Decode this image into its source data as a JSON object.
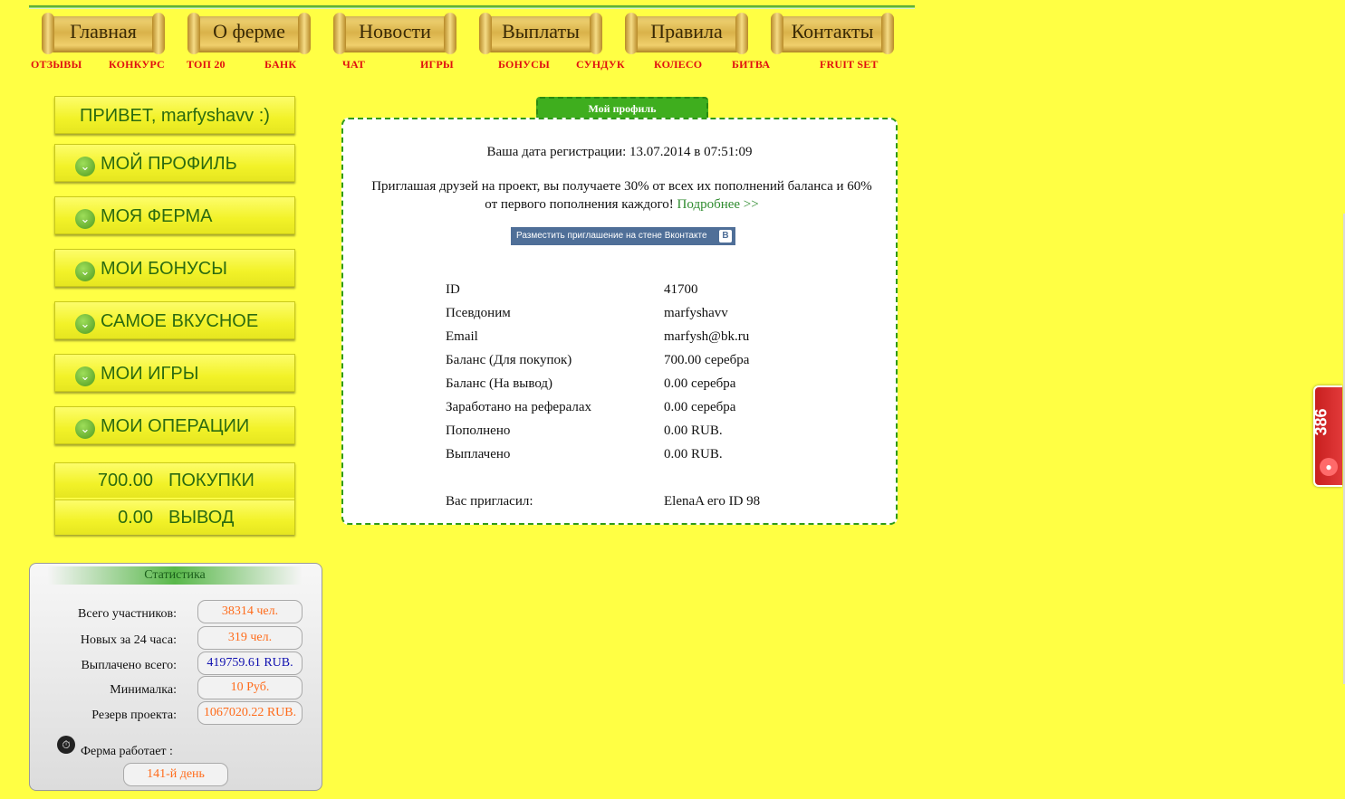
{
  "top_nav": [
    "Главная",
    "О ферме",
    "Новости",
    "Выплаты",
    "Правила",
    "Контакты"
  ],
  "sub_nav": [
    "ОТЗЫВЫ",
    "КОНКУРС",
    "ТОП 20",
    "БАНК",
    "ЧАТ",
    "ИГРЫ",
    "БОНУСЫ",
    "СУНДУК",
    "КОЛЕСО",
    "БИТВА",
    "FRUIT SET"
  ],
  "sidebar": {
    "greeting": "ПРИВЕТ, marfyshavv :)",
    "items": [
      "МОЙ ПРОФИЛЬ",
      "МОЯ ФЕРМА",
      "МОИ БОНУСЫ",
      "САМОЕ ВКУСНОЕ",
      "МОИ ИГРЫ",
      "МОИ ОПЕРАЦИИ"
    ],
    "balance_buy": {
      "value": "700.00",
      "label": "ПОКУПКИ"
    },
    "balance_out": {
      "value": "0.00",
      "label": "ВЫВОД"
    }
  },
  "stats": {
    "title": "Статистика",
    "rows": [
      {
        "label": "Всего участников:",
        "value": "38314 чел."
      },
      {
        "label": "Новых за 24 часа:",
        "value": "319 чел."
      },
      {
        "label": "Выплачено всего:",
        "value": "419759.61 RUB."
      },
      {
        "label": "Минималка:",
        "value": "10 Руб."
      },
      {
        "label": "Резерв проекта:",
        "value": "1067020.22 RUB."
      }
    ],
    "farm_label": "Ферма работает :",
    "farm_value": "141-й день"
  },
  "profile": {
    "tab_title": "Мой профиль",
    "reg_line": "Ваша дата регистрации: 13.07.2014 в 07:51:09",
    "invite_text": "Приглашая друзей на проект, вы получаете 30% от всех их пополнений баланса и 60% от первого пополнения каждого!",
    "invite_link": "Подробнее >>",
    "vk_button": "Разместить приглашение на стене Вконтакте",
    "vk_badge": "B",
    "rows": [
      {
        "label": "ID",
        "value": "41700"
      },
      {
        "label": "Псевдоним",
        "value": "marfyshavv"
      },
      {
        "label": "Email",
        "value": "marfysh@bk.ru"
      },
      {
        "label": "Баланс (Для покупок)",
        "value": "700.00 серебра"
      },
      {
        "label": "Баланс (На вывод)",
        "value": "0.00 серебра"
      },
      {
        "label": "Заработано на рефералах",
        "value": "0.00 серебра"
      },
      {
        "label": "Пополнено",
        "value": "0.00 RUB."
      },
      {
        "label": "Выплачено",
        "value": "0.00 RUB."
      }
    ],
    "referrer": {
      "label": "Вас пригласил:",
      "value": "ElenaA его ID 98"
    }
  },
  "side_widget": {
    "count": "386"
  },
  "colors": {
    "page_bg": "#ffff44",
    "accent_green": "#3fae1e",
    "link_red": "#e01010",
    "stat_orange": "#ff6b1a"
  }
}
